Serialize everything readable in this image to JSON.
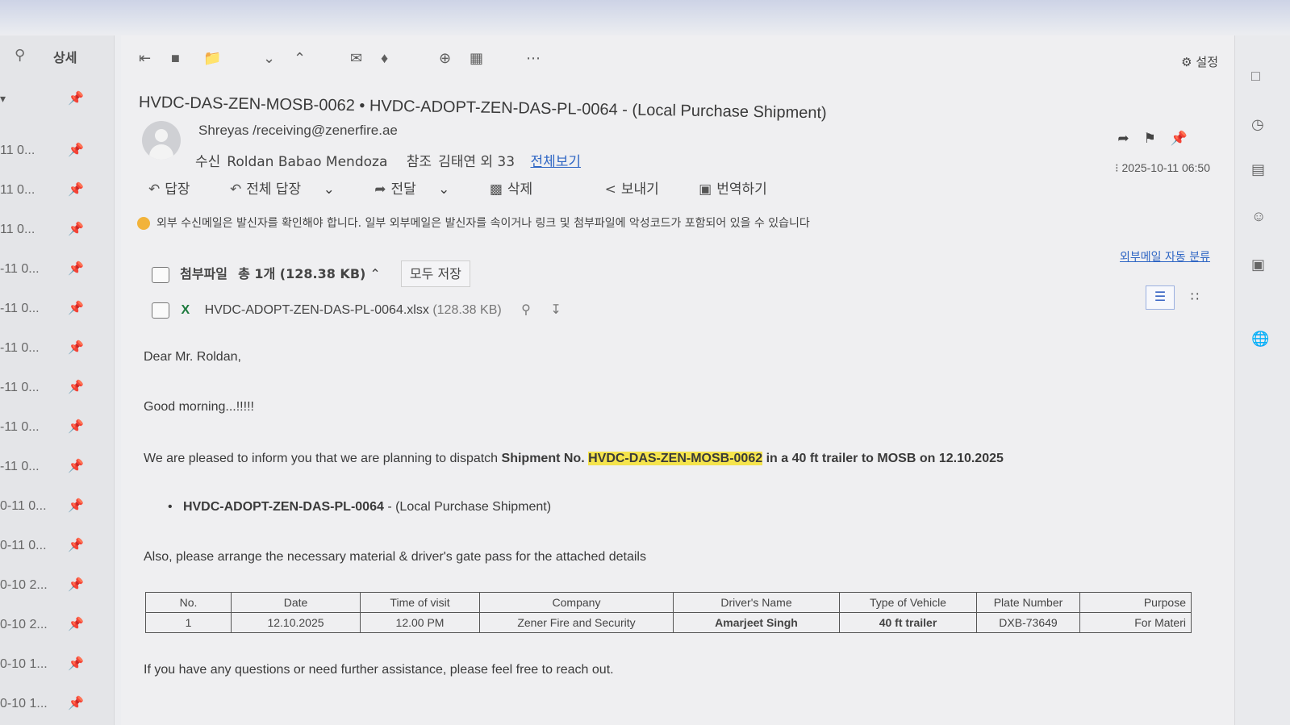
{
  "left_panel": {
    "search_icon": "search-icon",
    "detail_label": "상세",
    "filter_icon": "dropdown-icon",
    "rows": [
      {
        "date": "11 0..."
      },
      {
        "date": "11 0..."
      },
      {
        "date": "11 0..."
      },
      {
        "date": "-11 0..."
      },
      {
        "date": "-11 0..."
      },
      {
        "date": "-11 0..."
      },
      {
        "date": "-11 0..."
      },
      {
        "date": "-11 0..."
      },
      {
        "date": "-11 0..."
      },
      {
        "date": "0-11 0..."
      },
      {
        "date": "0-11 0..."
      },
      {
        "date": "0-10 2..."
      },
      {
        "date": "0-10 2..."
      },
      {
        "date": "0-10 1..."
      },
      {
        "date": "0-10 1..."
      }
    ]
  },
  "toolbar": {
    "settings_label": "설정"
  },
  "email": {
    "subject": "HVDC-DAS-ZEN-MOSB-0062 • HVDC-ADOPT-ZEN-DAS-PL-0064 - (Local Purchase Shipment)",
    "sender": "Shreyas  /receiving@zenerfire.ae",
    "to_label": "수신",
    "to": "Roldan Babao Mendoza",
    "cc_label": "참조",
    "cc": "김태연 외 33",
    "view_all": "전체보기",
    "date": "2025-10-11 06:50",
    "actions": {
      "reply": "답장",
      "reply_all": "전체 답장",
      "forward": "전달",
      "delete": "삭제",
      "send": "보내기",
      "translate": "번역하기"
    },
    "warning": "외부 수신메일은 발신자를 확인해야 합니다. 일부 외부메일은 발신자를 속이거나 링크 및 첨부파일에 악성코드가 포함되어 있을 수 있습니다",
    "auto_sort": "외부메일 자동 분류",
    "attachments": {
      "label": "첨부파일",
      "summary": "총 1개  (128.38 KB)",
      "save_all": "모두 저장",
      "file_name": "HVDC-ADOPT-ZEN-DAS-PL-0064.xlsx",
      "file_size": "(128.38 KB)"
    },
    "body": {
      "greeting": "Dear Mr. Roldan,",
      "morning": "Good morning...!!!!!",
      "line1_a": "We are pleased to inform you that we are planning to dispatch ",
      "line1_b": "Shipment No. ",
      "line1_hl": "HVDC-DAS-ZEN-MOSB-0062",
      "line1_c": " in a 40 ft trailer to MOSB on 12.10.2025",
      "bullet_a": "HVDC-ADOPT-ZEN-DAS-PL-0064",
      "bullet_b": " - (Local Purchase Shipment)",
      "arrange": "Also, please arrange the necessary material & driver's gate pass for the attached details",
      "closing": "If you have any questions or need further assistance, please feel free to reach out."
    },
    "table": {
      "headers": [
        "No.",
        "Date",
        "Time of visit",
        "Company",
        "Driver's Name",
        "Type of Vehicle",
        "Plate Number",
        "Purpose"
      ],
      "row": [
        "1",
        "12.10.2025",
        "12.00 PM",
        "Zener Fire and Security",
        "Amarjeet Singh",
        "40 ft trailer",
        "DXB-73649",
        "For Materi"
      ]
    }
  }
}
